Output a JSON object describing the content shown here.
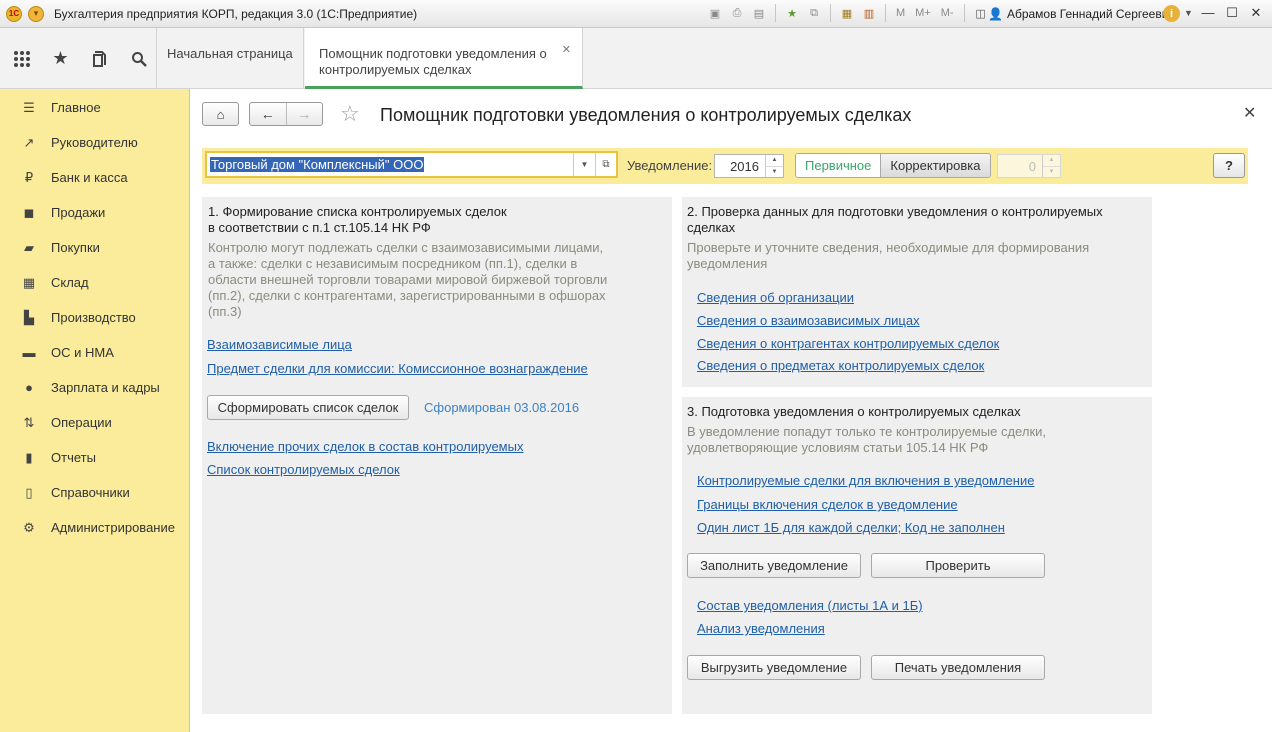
{
  "window": {
    "title": "Бухгалтерия предприятия КОРП, редакция 3.0  (1С:Предприятие)",
    "user": "Абрамов Геннадий Сергеевич",
    "tools": [
      "M",
      "M+",
      "M-"
    ]
  },
  "tabs": {
    "home": "Начальная страница",
    "active": "Помощник подготовки уведомления о контролируемых сделках"
  },
  "sidebar": {
    "items": [
      {
        "label": "Главное",
        "icon": "menu-icon"
      },
      {
        "label": "Руководителю",
        "icon": "trend-icon"
      },
      {
        "label": "Банк и касса",
        "icon": "ruble-icon"
      },
      {
        "label": "Продажи",
        "icon": "bag-icon"
      },
      {
        "label": "Покупки",
        "icon": "cart-icon"
      },
      {
        "label": "Склад",
        "icon": "warehouse-icon"
      },
      {
        "label": "Производство",
        "icon": "factory-icon"
      },
      {
        "label": "ОС и НМА",
        "icon": "truck-icon"
      },
      {
        "label": "Зарплата и кадры",
        "icon": "person-icon"
      },
      {
        "label": "Операции",
        "icon": "operations-icon"
      },
      {
        "label": "Отчеты",
        "icon": "chart-icon"
      },
      {
        "label": "Справочники",
        "icon": "books-icon"
      },
      {
        "label": "Администрирование",
        "icon": "gear-icon"
      }
    ]
  },
  "page": {
    "title": "Помощник подготовки уведомления о контролируемых сделках"
  },
  "toolbar": {
    "organization": "Торговый дом \"Комплексный\" ООО",
    "notice_label": "Уведомление:",
    "year": "2016",
    "primary": "Первичное",
    "correction": "Корректировка",
    "correction_number": "0",
    "help": "?"
  },
  "section1": {
    "title_line1": "1. Формирование списка контролируемых сделок",
    "title_line2": "в соответствии с п.1 ст.105.14 НК РФ",
    "desc_lines": [
      "Контролю могут подлежать сделки с взаимозависимыми лицами,",
      "а также: сделки с независимым посредником (пп.1), сделки в",
      "области внешней торговли товарами мировой биржевой торговли",
      "(пп.2), сделки с контрагентами, зарегистрированными в офшорах",
      "(пп.3)"
    ],
    "link_related": "Взаимозависимые лица",
    "link_subject": "Предмет сделки для комиссии: Комиссионное вознаграждение",
    "btn_form": "Сформировать список сделок",
    "status": "Сформирован 03.08.2016",
    "link_include": "Включение прочих сделок в состав контролируемых",
    "link_list": "Список контролируемых сделок"
  },
  "section2": {
    "title_line1": "2. Проверка данных для подготовки уведомления о контролируемых",
    "title_line2": "сделках",
    "desc_line1": "Проверьте и уточните сведения, необходимые для формирования",
    "desc_line2": "уведомления",
    "links": [
      "Сведения об организации",
      "Сведения о взаимозависимых лицах",
      "Сведения о контрагентах контролируемых сделок",
      "Сведения о предметах контролируемых сделок"
    ]
  },
  "section3": {
    "title": "3. Подготовка уведомления о контролируемых сделках",
    "desc_line1": "В уведомление попадут только те контролируемые сделки,",
    "desc_line2": "удовлетворяющие условиям статьи 105.14 НК РФ",
    "links": [
      "Контролируемые сделки для включения в уведомление",
      "Границы включения сделок в уведомление",
      "Один лист 1Б для каждой сделки; Код не заполнен"
    ],
    "btn_fill": "Заполнить уведомление",
    "btn_check": "Проверить",
    "link_composition": "Состав уведомления (листы 1А и 1Б)",
    "link_analysis": "Анализ уведомления",
    "btn_export": "Выгрузить уведомление",
    "btn_print": "Печать уведомления"
  }
}
